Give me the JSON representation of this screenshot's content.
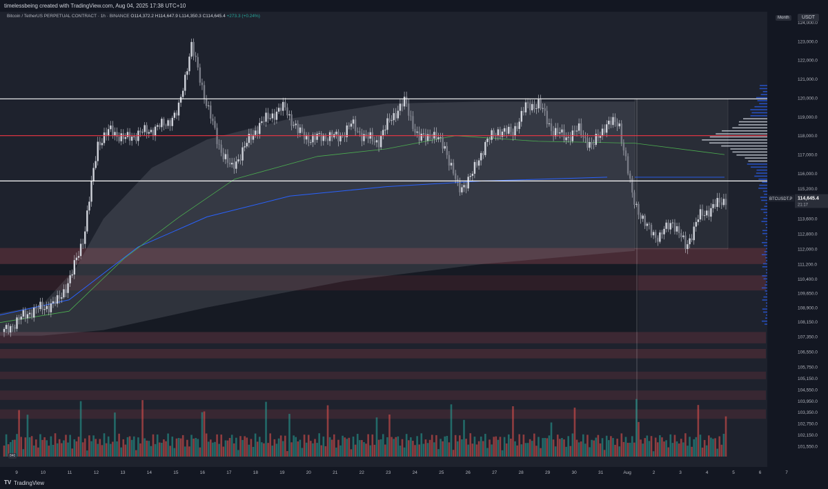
{
  "header": {
    "author_line": "timelessbeing created with TradingView.com, Aug 04, 2025 17:38 UTC+10"
  },
  "legend": {
    "symbol": "Bitcoin / TetherUS PERPETUAL CONTRACT · 1h · BINANCE",
    "open": "O114,372.2",
    "high": "H114,647.9",
    "low": "L114,350.3",
    "close": "C114,645.4",
    "change": "+273.3 (+0.24%)"
  },
  "toolbar": {
    "month_label": "Month",
    "currency_label": "USDT"
  },
  "price_scale": {
    "labels": [
      "124,000.0",
      "123,000.0",
      "122,000.0",
      "121,000.0",
      "120,000.0",
      "119,000.0",
      "118,000.0",
      "117,000.0",
      "116,000.0",
      "115,200.0",
      "113,600.0",
      "112,800.0",
      "112,000.0",
      "111,200.0",
      "110,400.0",
      "109,650.0",
      "108,900.0",
      "108,150.0",
      "107,350.0",
      "106,550.0",
      "105,750.0",
      "105,150.0",
      "104,550.0",
      "103,950.0",
      "103,350.0",
      "102,750.0",
      "102,150.0",
      "101,550.0"
    ],
    "current_symbol": "BTCUSDT.P",
    "current_price": "114,645.4",
    "countdown": "21:17"
  },
  "time_scale": {
    "labels": [
      "9",
      "10",
      "11",
      "12",
      "13",
      "14",
      "15",
      "16",
      "17",
      "18",
      "19",
      "20",
      "21",
      "22",
      "23",
      "24",
      "25",
      "26",
      "27",
      "28",
      "29",
      "30",
      "31",
      "Aug",
      "2",
      "3",
      "4",
      "5",
      "6",
      "7"
    ]
  },
  "volume_badge": "840",
  "footer": {
    "logo": "TV",
    "brand": "TradingView"
  },
  "colors": {
    "background": "#131722",
    "up": "#26a69a",
    "down": "#ef5350",
    "candle": "#d1d4dc",
    "level_white": "#ffffff",
    "level_red": "#f23645",
    "vwap_blue": "#2962ff",
    "vwap_green": "#4caf50"
  },
  "chart_data": {
    "type": "candlestick",
    "timeframe": "1h",
    "x_categories": [
      "9",
      "10",
      "11",
      "12",
      "13",
      "14",
      "15",
      "16",
      "17",
      "18",
      "19",
      "20",
      "21",
      "22",
      "23",
      "24",
      "25",
      "26",
      "27",
      "28",
      "29",
      "30",
      "31",
      "Aug",
      "2",
      "3",
      "4"
    ],
    "close_path": [
      107600,
      108200,
      108700,
      108900,
      109200,
      110500,
      112800,
      117600,
      118300,
      117800,
      118100,
      118300,
      118600,
      119200,
      122800,
      120100,
      117600,
      116200,
      117400,
      118500,
      119100,
      119500,
      118200,
      117800,
      118000,
      117900,
      118600,
      117900,
      117700,
      119000,
      119800,
      117800,
      118100,
      117400,
      115100,
      115900,
      117600,
      118300,
      118100,
      119500,
      119700,
      118300,
      117900,
      118300,
      117400,
      118600,
      118700,
      114800,
      113200,
      112600,
      113500,
      112100,
      113700,
      114200,
      114645.4
    ],
    "horizontal_levels": [
      {
        "price": 119950,
        "color": "white"
      },
      {
        "price": 118000,
        "color": "red"
      },
      {
        "price": 115600,
        "color": "white"
      }
    ],
    "ylim": [
      101000,
      124200
    ]
  }
}
